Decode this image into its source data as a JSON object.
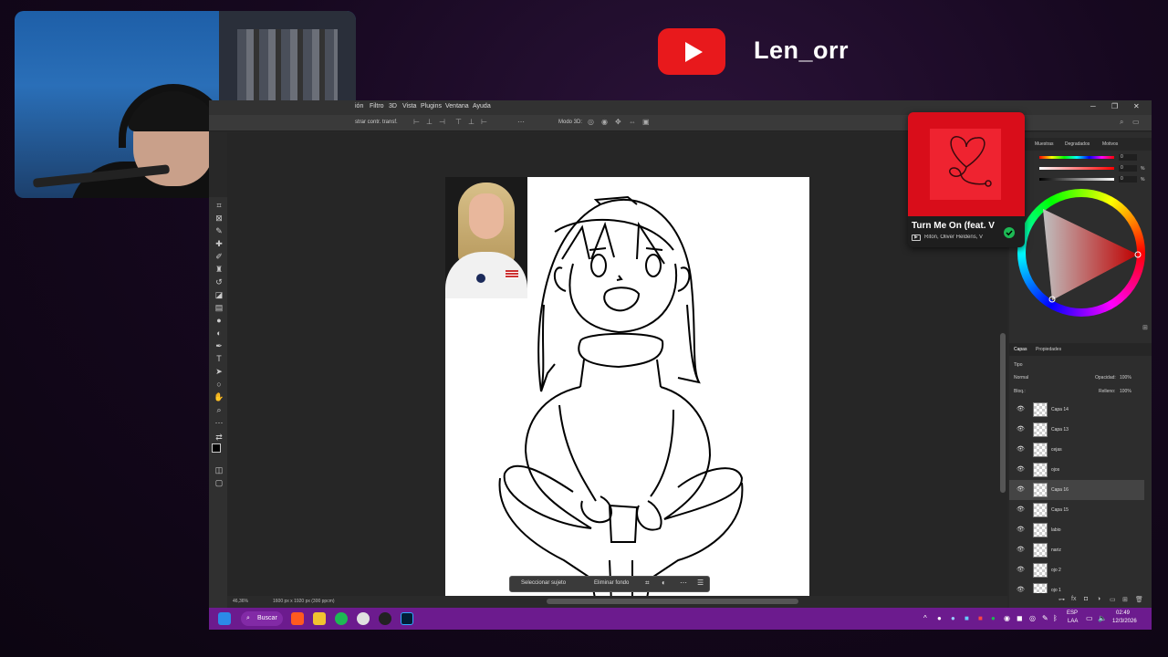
{
  "overlay": {
    "channel_name": "Len_orr"
  },
  "photoshop": {
    "menu": [
      "ión",
      "Filtro",
      "3D",
      "Vista",
      "Plugins",
      "Ventana",
      "Ayuda"
    ],
    "options_bar": {
      "transform_label": "strar contr. transf.",
      "mode_3d": "Modo 3D:"
    },
    "context_bar": {
      "select_subject": "Seleccionar sujeto",
      "remove_background": "Eliminar fondo"
    },
    "status": {
      "zoom": "46,36%",
      "doc_info": "1600 px x 1920 px (300 ppcm)"
    },
    "right_panels": {
      "tabs_top": [
        "Muestras",
        "Degradados",
        "Motivos"
      ],
      "slider_values": [
        "0",
        "0",
        "0"
      ],
      "slider_units": [
        "",
        "%",
        "%"
      ],
      "tabs_layers": [
        "Capas",
        "Propiedades"
      ],
      "filter_kind": "Tipo",
      "blend_mode": "Normal",
      "opacity_label": "Opacidad:",
      "opacity": "100%",
      "lock_label": "Bloq.:",
      "fill_label": "Relleno:",
      "fill": "100%",
      "layers": [
        "Capa 14",
        "Capa 13",
        "cejas",
        "ojos",
        "Capa 16",
        "Capa 15",
        "labio",
        "nariz",
        "ojo 2",
        "ojo 1"
      ],
      "active_layer_index": 4
    }
  },
  "spotify": {
    "song_title": "Turn Me On (feat. V",
    "artists": "Riton, Oliver Heldens, V",
    "colors": {
      "album_bg": "#d90d1a",
      "check": "#1db954"
    }
  },
  "taskbar": {
    "search_label": "Buscar",
    "tray": {
      "lang": "ESP",
      "region": "LAA",
      "time": "02:49",
      "date": "12/3/2026"
    }
  }
}
